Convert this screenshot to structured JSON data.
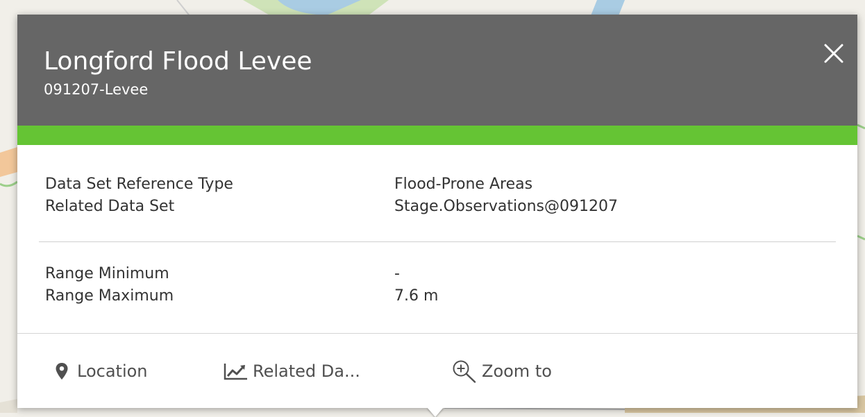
{
  "popup": {
    "title": "Longford Flood Levee",
    "subtitle": "091207-Levee",
    "close_icon": "close-icon"
  },
  "attributes": {
    "group1": [
      {
        "label": "Data Set Reference Type",
        "value": "Flood-Prone Areas"
      },
      {
        "label": "Related Data Set",
        "value": "Stage.Observations@091207"
      }
    ],
    "group2": [
      {
        "label": "Range Minimum",
        "value": "-"
      },
      {
        "label": "Range Maximum",
        "value": "7.6 m"
      }
    ]
  },
  "actions": [
    {
      "label": "Location",
      "icon": "map-pin-icon"
    },
    {
      "label": "Related Da...",
      "icon": "line-chart-icon"
    },
    {
      "label": "Zoom to",
      "icon": "zoom-in-icon"
    }
  ],
  "colors": {
    "header": "#666666",
    "accent": "#65c434",
    "text": "#333333",
    "action_text": "#505050"
  }
}
